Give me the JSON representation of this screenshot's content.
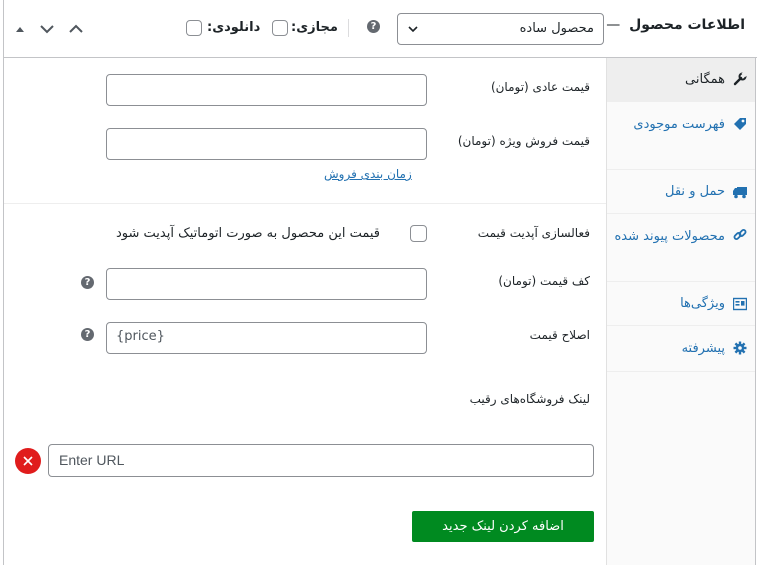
{
  "header": {
    "title": "اطلاعات محصول",
    "title_dash": "—",
    "product_type": "محصول ساده",
    "virtual_label": "مجازی:",
    "downloadable_label": "دانلودی:",
    "help_glyph": "?"
  },
  "tabs": [
    {
      "label": "همگانی",
      "icon": "wrench-icon"
    },
    {
      "label": "فهرست موجودی",
      "icon": "tag-icon"
    },
    {
      "label": "حمل و نقل",
      "icon": "truck-icon"
    },
    {
      "label": "محصولات پیوند شده",
      "icon": "link-icon"
    },
    {
      "label": "ویژگی‌ها",
      "icon": "list-icon"
    },
    {
      "label": "پیشرفته",
      "icon": "gear-icon"
    }
  ],
  "general": {
    "regular_price_label": "قیمت عادی (تومان)",
    "regular_price_value": "",
    "sale_price_label": "قیمت فروش ویژه (تومان)",
    "sale_price_value": "",
    "schedule_link": "زمان بندی فروش"
  },
  "auto_update": {
    "activate_label": "فعالسازی آپدیت قیمت",
    "checkbox_text": "قیمت این محصول به صورت اتوماتیک آپدیت شود",
    "min_price_label": "کف قیمت (تومان)",
    "min_price_value": "",
    "price_fix_label": "اصلاح قیمت",
    "price_fix_value": "{price}",
    "competitor_links_label": "لینک فروشگاه‌های رقیب",
    "url_placeholder": "Enter URL",
    "add_link_button": "اضافه کردن لینک جدید",
    "remove_glyph": "×"
  },
  "colors": {
    "link": "#2271b1",
    "green_button": "#008a20",
    "delete_button": "#e01c1c"
  }
}
